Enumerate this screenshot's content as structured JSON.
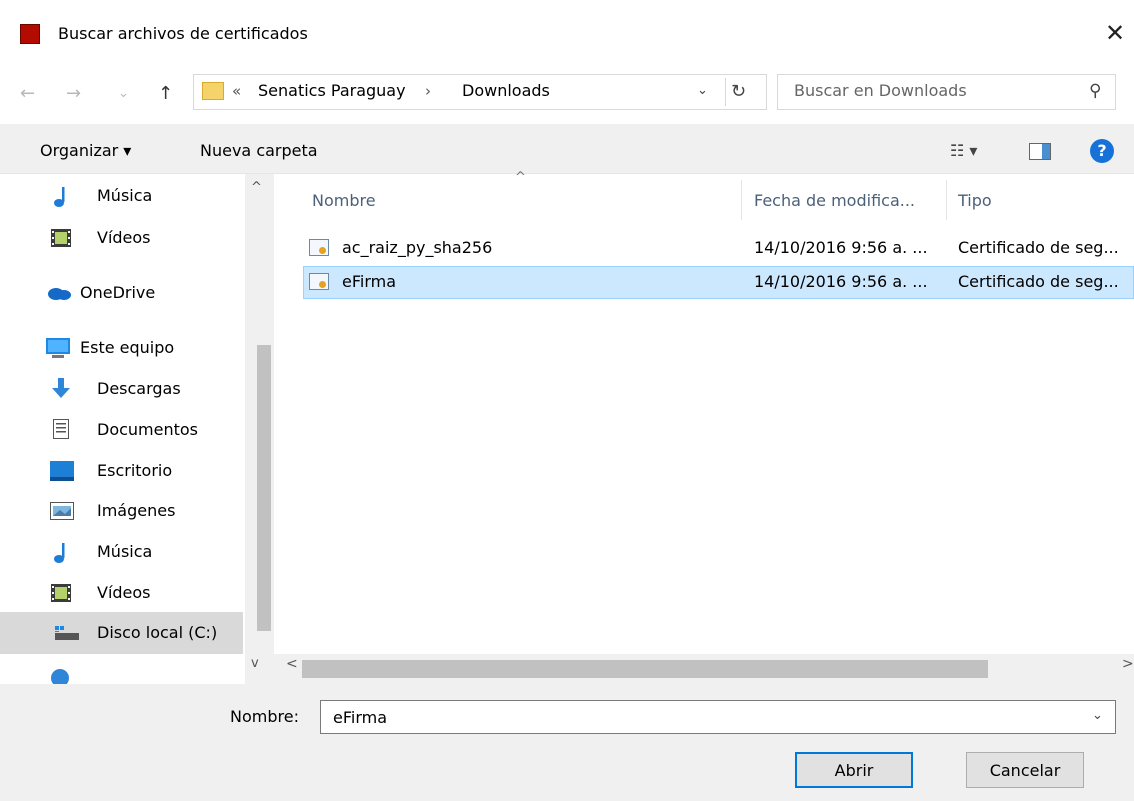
{
  "window": {
    "title": "Buscar archivos de certificados",
    "close_glyph": "✕"
  },
  "nav": {
    "back_glyph": "←",
    "forward_glyph": "→",
    "recent_glyph": "⌄",
    "up_glyph": "↑",
    "breadcrumb_prefix": "«",
    "breadcrumb": [
      "Senatics Paraguay",
      "Downloads"
    ],
    "breadcrumb_sep": "›",
    "dropdown_glyph": "⌄",
    "refresh_glyph": "↻",
    "search_placeholder": "Buscar en Downloads",
    "search_glyph": "⚲"
  },
  "commandbar": {
    "organize": "Organizar ▾",
    "new_folder": "Nueva carpeta",
    "views_glyph": "☷ ▾",
    "help": "?"
  },
  "sidebar": {
    "items": [
      {
        "label": "Música",
        "icon": "music-icon"
      },
      {
        "label": "Vídeos",
        "icon": "video-icon"
      },
      {
        "label": "OneDrive",
        "icon": "onedrive-icon"
      },
      {
        "label": "Este equipo",
        "icon": "computer-icon"
      },
      {
        "label": "Descargas",
        "icon": "downloads-icon"
      },
      {
        "label": "Documentos",
        "icon": "documents-icon"
      },
      {
        "label": "Escritorio",
        "icon": "desktop-icon"
      },
      {
        "label": "Imágenes",
        "icon": "pictures-icon"
      },
      {
        "label": "Música",
        "icon": "music-icon"
      },
      {
        "label": "Vídeos",
        "icon": "video-icon"
      },
      {
        "label": "Disco local (C:)",
        "icon": "drive-icon"
      }
    ],
    "scroll_up": "^",
    "scroll_down": "v"
  },
  "files": {
    "columns": [
      "Nombre",
      "Fecha de modifica...",
      "Tipo"
    ],
    "sort_glyph": "^",
    "rows": [
      {
        "name": "ac_raiz_py_sha256",
        "date": "14/10/2016 9:56 a. ...",
        "type": "Certificado de seg..."
      },
      {
        "name": "eFirma",
        "date": "14/10/2016 9:56 a. ...",
        "type": "Certificado de seg..."
      }
    ],
    "hscroll_left": "<",
    "hscroll_right": ">"
  },
  "footer": {
    "name_label": "Nombre:",
    "name_value": "eFirma",
    "dropdown_glyph": "⌄",
    "open": "Abrir",
    "cancel": "Cancelar"
  },
  "colors": {
    "accent": "#0078d7",
    "selection": "#cce8ff",
    "selection_border": "#99d1ff"
  }
}
